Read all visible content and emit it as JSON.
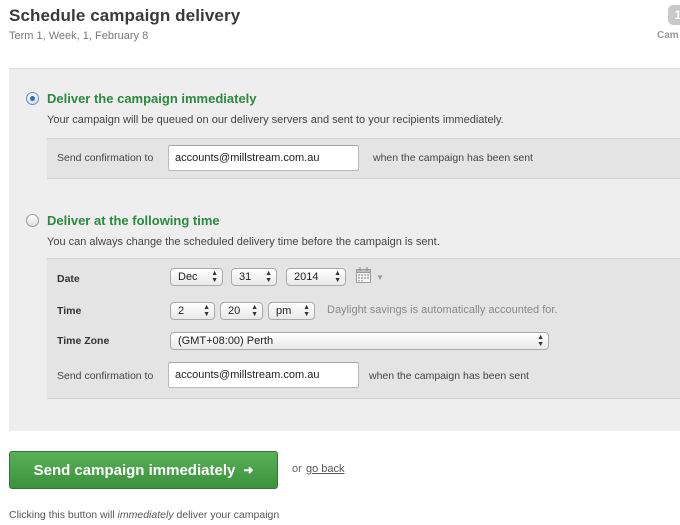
{
  "header": {
    "title": "Schedule campaign delivery",
    "subtitle": "Term 1, Week, 1, February 8",
    "corner_badge": "1",
    "corner_label": "Cam"
  },
  "immediate": {
    "selected": true,
    "title": "Deliver the campaign immediately",
    "description": "Your campaign will be queued on our delivery servers and sent to your recipients immediately.",
    "confirm_label": "Send confirmation to",
    "confirm_email": "accounts@millstream.com.au",
    "confirm_suffix": "when the campaign has been sent"
  },
  "scheduled": {
    "selected": false,
    "title": "Deliver at the following time",
    "description": "You can always change the scheduled delivery time before the campaign is sent.",
    "date_label": "Date",
    "date_month": "Dec",
    "date_day": "31",
    "date_year": "2014",
    "time_label": "Time",
    "time_hour": "2",
    "time_minute": "20",
    "time_ampm": "pm",
    "time_hint": "Daylight savings is automatically accounted for.",
    "timezone_label": "Time Zone",
    "timezone_value": "(GMT+08:00) Perth",
    "confirm_label": "Send confirmation to",
    "confirm_email": "accounts@millstream.com.au",
    "confirm_suffix": "when the campaign has been sent"
  },
  "actions": {
    "send_label": "Send campaign immediately",
    "send_arrow": "➜",
    "or_text": "or",
    "go_back_label": "go back"
  },
  "footer": {
    "note_before": "Clicking this button will ",
    "note_emphasis": "immediately",
    "note_after": " deliver your campaign"
  },
  "colors": {
    "accent_green": "#2b8a3e",
    "button_green": "#4aa349",
    "radio_blue": "#2a6fc9"
  }
}
